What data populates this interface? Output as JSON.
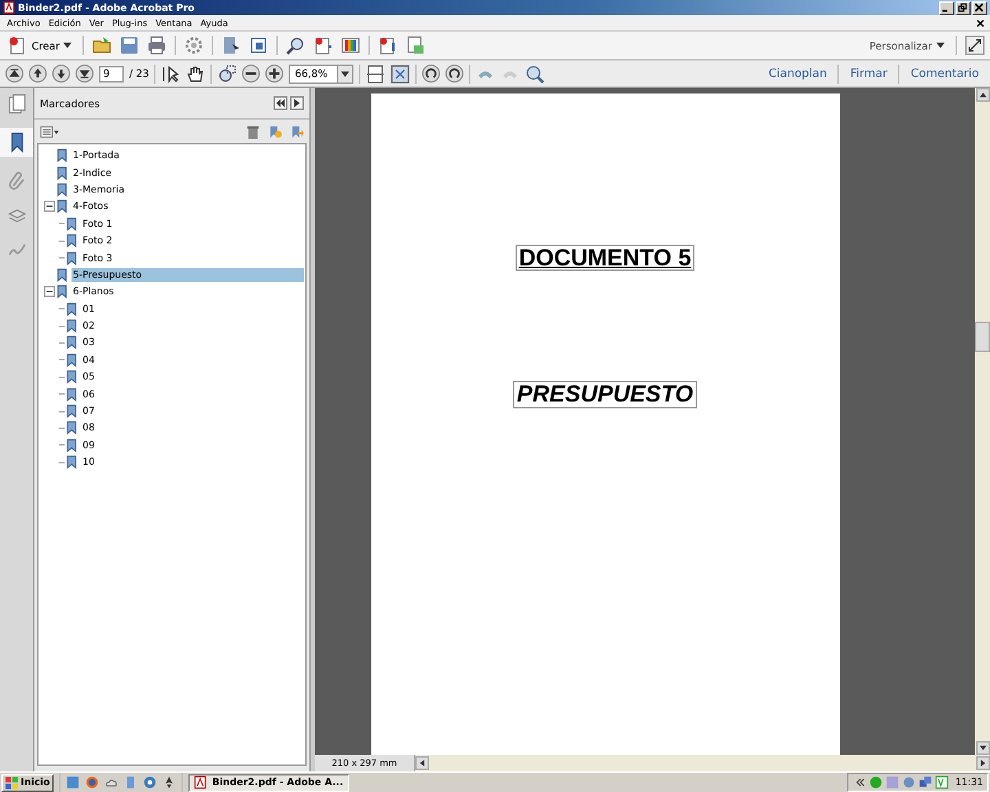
{
  "window": {
    "title": "Binder2.pdf - Adobe Acrobat Pro"
  },
  "menu": [
    "Archivo",
    "Edición",
    "Ver",
    "Plug-ins",
    "Ventana",
    "Ayuda"
  ],
  "toolbar": {
    "create_label": "Crear",
    "customize_label": "Personalizar"
  },
  "nav_toolbar": {
    "page": "9",
    "total": "/ 23",
    "zoom": "66,8%",
    "links": [
      "Cianoplan",
      "Firmar",
      "Comentario"
    ]
  },
  "panel": {
    "title": "Marcadores"
  },
  "bookmarks": [
    {
      "label": "1-Portada",
      "selected": false
    },
    {
      "label": "2-Indice",
      "selected": false
    },
    {
      "label": "3-Memoria",
      "selected": false
    },
    {
      "label": "4-Fotos",
      "selected": false,
      "expanded": true,
      "children": [
        {
          "label": "Foto 1",
          "selected": false
        },
        {
          "label": "Foto 2",
          "selected": false
        },
        {
          "label": "Foto 3",
          "selected": false
        }
      ]
    },
    {
      "label": "5-Presupuesto",
      "selected": true
    },
    {
      "label": "6-Planos",
      "selected": false,
      "expanded": true,
      "children": [
        {
          "label": "01",
          "selected": false
        },
        {
          "label": "02",
          "selected": false
        },
        {
          "label": "03",
          "selected": false
        },
        {
          "label": "04",
          "selected": false
        },
        {
          "label": "05",
          "selected": false
        },
        {
          "label": "06",
          "selected": false
        },
        {
          "label": "07",
          "selected": false
        },
        {
          "label": "08",
          "selected": false
        },
        {
          "label": "09",
          "selected": false
        },
        {
          "label": "10",
          "selected": false
        }
      ]
    }
  ],
  "document": {
    "heading": "DOCUMENTO 5",
    "subheading": "PRESUPUESTO",
    "page_size": "210 x 297 mm"
  },
  "taskbar": {
    "start": "Inicio",
    "task": "Binder2.pdf - Adobe A...",
    "clock": "11:31"
  }
}
